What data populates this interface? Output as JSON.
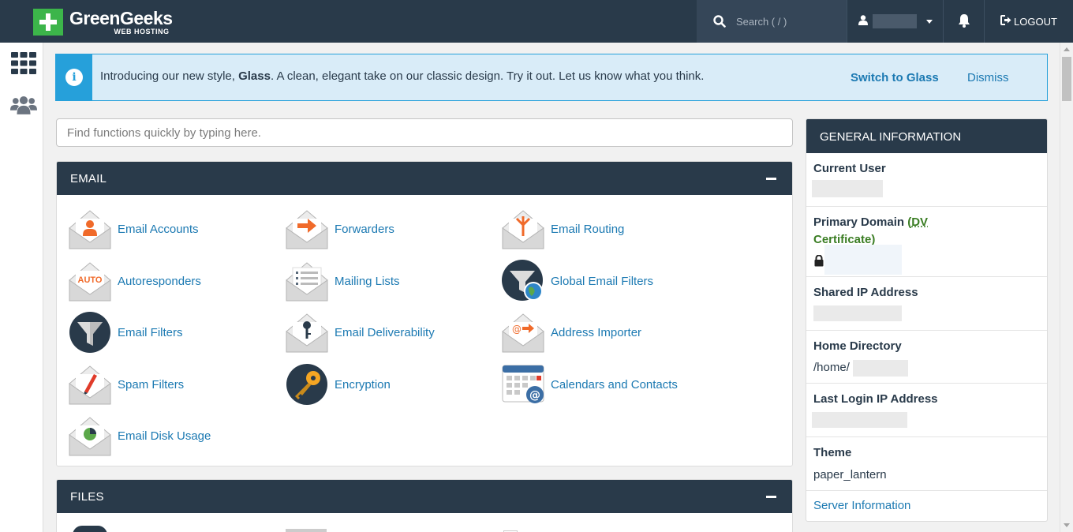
{
  "topbar": {
    "brand": "GreenGeeks",
    "brand_sub": "WEB HOSTING",
    "search_placeholder": "Search ( / )",
    "logout_label": "LOGOUT"
  },
  "banner": {
    "message_prefix": "Introducing our new style, ",
    "message_bold": "Glass",
    "message_suffix": ". A clean, elegant take on our classic design. Try it out. Let us know what you think.",
    "switch_label": "Switch to Glass",
    "dismiss_label": "Dismiss"
  },
  "find": {
    "placeholder": "Find functions quickly by typing here."
  },
  "email": {
    "title": "EMAIL",
    "items": [
      {
        "label": "Email Accounts",
        "icon": "email-accounts-icon"
      },
      {
        "label": "Forwarders",
        "icon": "forwarders-icon"
      },
      {
        "label": "Email Routing",
        "icon": "email-routing-icon"
      },
      {
        "label": "Autoresponders",
        "icon": "autoresponders-icon"
      },
      {
        "label": "Mailing Lists",
        "icon": "mailing-lists-icon"
      },
      {
        "label": "Global Email Filters",
        "icon": "global-email-filters-icon"
      },
      {
        "label": "Email Filters",
        "icon": "email-filters-icon"
      },
      {
        "label": "Email Deliverability",
        "icon": "email-deliverability-icon"
      },
      {
        "label": "Address Importer",
        "icon": "address-importer-icon"
      },
      {
        "label": "Spam Filters",
        "icon": "spam-filters-icon"
      },
      {
        "label": "Encryption",
        "icon": "encryption-icon"
      },
      {
        "label": "Calendars and Contacts",
        "icon": "calendars-icon"
      },
      {
        "label": "Email Disk Usage",
        "icon": "email-disk-usage-icon"
      }
    ],
    "auto_badge": "AUTO"
  },
  "files": {
    "title": "FILES"
  },
  "general_info": {
    "title": "GENERAL INFORMATION",
    "current_user_label": "Current User",
    "primary_domain_label": "Primary Domain",
    "dv_open": "(",
    "dv_text": "DV",
    "certificate_text": "Certificate)",
    "shared_ip_label": "Shared IP Address",
    "home_dir_label": "Home Directory",
    "home_dir_value": "/home/",
    "last_login_label": "Last Login IP Address",
    "theme_label": "Theme",
    "theme_value": "paper_lantern",
    "server_info_link": "Server Information"
  },
  "colors": {
    "navy": "#293a4a",
    "link": "#1b79b2",
    "info_blue": "#26a0da",
    "brand_green": "#3cb54a",
    "accent_orange": "#f06a2a"
  }
}
